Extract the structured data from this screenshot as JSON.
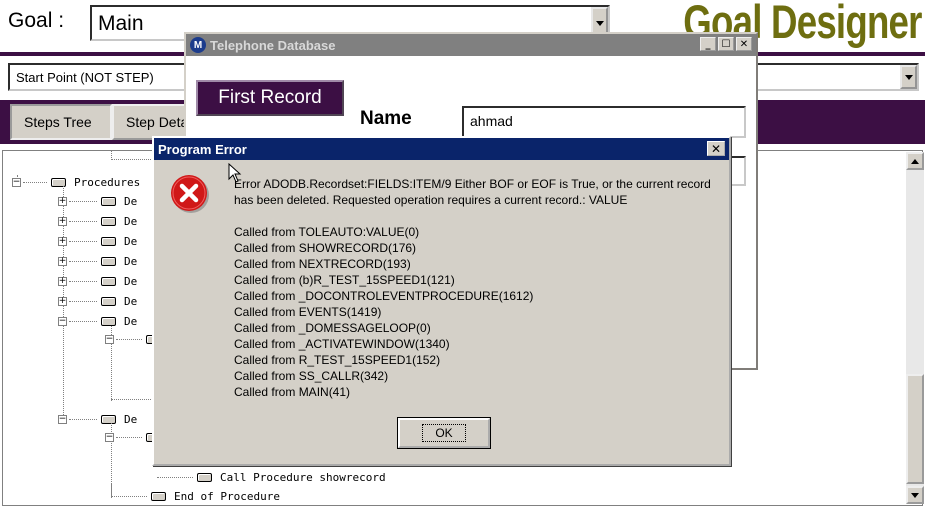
{
  "goal": {
    "label": "Goal :",
    "selected": "Main"
  },
  "brand": "Goal Designer",
  "start_point": {
    "selected": "Start Point (NOT STEP)"
  },
  "tabs": [
    {
      "label": "Steps Tree"
    },
    {
      "label": "Step Details"
    }
  ],
  "tree": {
    "procedures": "Procedures",
    "items": [
      {
        "label": "De"
      },
      {
        "label": "De"
      },
      {
        "label": "De"
      },
      {
        "label": "De"
      },
      {
        "label": "De"
      },
      {
        "label": "De"
      },
      {
        "label": "De"
      },
      {
        "label": "De"
      }
    ],
    "call_procedure": "Call Procedure showrecord",
    "end_procedure": "End of Procedure"
  },
  "telephone_window": {
    "title": "Telephone Database",
    "icon_letter": "M",
    "first_record_label": "First Record",
    "name_label": "Name",
    "name_value": "ahmad"
  },
  "error_dialog": {
    "title": "Program Error",
    "message": "Error ADODB.Recordset:FIELDS:ITEM/9  Either BOF or EOF is True, or the current record has been deleted. Requested operation requires a current record.: VALUE",
    "call_stack": [
      "Called from TOLEAUTO:VALUE(0)",
      "Called from SHOWRECORD(176)",
      "Called from NEXTRECORD(193)",
      "Called from (b)R_TEST_15SPEED1(121)",
      "Called from _DOCONTROLEVENTPROCEDURE(1612)",
      "Called from EVENTS(1419)",
      "Called from _DOMESSAGELOOP(0)",
      "Called from _ACTIVATEWINDOW(1340)",
      "Called from R_TEST_15SPEED1(152)",
      "Called from SS_CALLR(342)",
      "Called from MAIN(41)"
    ],
    "ok_label": "OK"
  },
  "colors": {
    "purple_bar": "#3c0f44",
    "brand_olive": "#6e6e10",
    "title_active": "#0a246a",
    "title_inactive": "#808080",
    "error_red": "#d01818"
  },
  "icons": [
    "chevron-down-icon",
    "error-icon",
    "close-icon",
    "minimize-icon",
    "maximize-icon",
    "arrow-up-icon",
    "arrow-down-icon",
    "mouse-cursor-icon"
  ]
}
